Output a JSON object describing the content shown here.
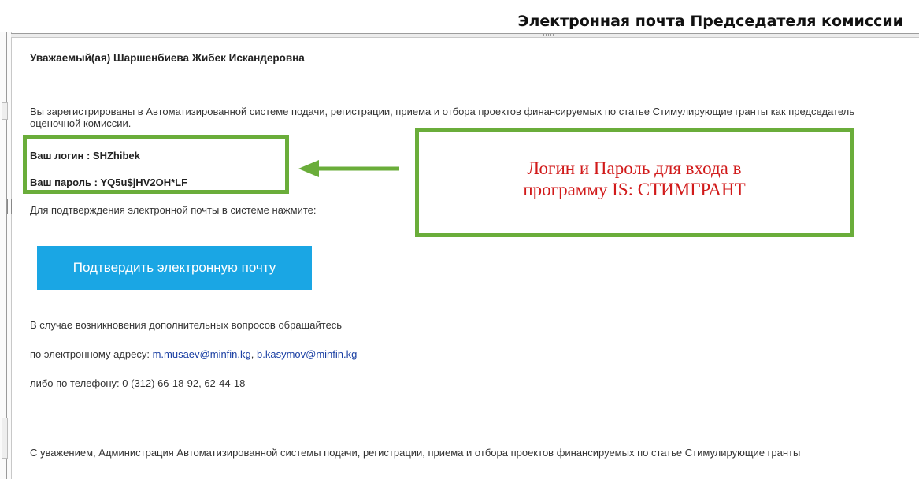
{
  "document": {
    "heading": "Электронная почта Председателя комиссии"
  },
  "email": {
    "greeting": "Уважаемый(ая) Шаршенбиева Жибек Искандеровна",
    "intro": "Вы зарегистрированы в Автоматизированной системе подачи, регистрации, приема и отбора проектов финансируемых по статье Стимулирующие гранты как председатель оценочной комиссии.",
    "login_line": "Ваш логин : SHZhibek",
    "password_line": "Ваш пароль : YQ5u$jHV2OH*LF",
    "confirm_prompt": "Для подтверждения электронной почты в системе нажмите:",
    "confirm_button": "Подтвердить электронную почту",
    "help_line1": "В случае возникновения дополнительных вопросов обращайтесь",
    "help_line2_prefix": "по электронному адресу: ",
    "email1": "m.musaev@minfin.kg",
    "separator": ", ",
    "email2": "b.kasymov@minfin.kg",
    "help_line3": "либо по телефону: 0 (312) 66-18-92, 62-44-18",
    "closing": "С уважением, Администрация Автоматизированной системы подачи, регистрации, приема и отбора проектов финансируемых по статье Стимулирующие гранты"
  },
  "annotation": {
    "callout_line1": "Логин и Пароль для входа в",
    "callout_line2": "программу IS: СТИМГРАНТ",
    "highlight_color": "#6aad3a",
    "text_color": "#d11a1a"
  },
  "colors": {
    "button_bg": "#1aa6e4",
    "link": "#1a3fa3"
  }
}
